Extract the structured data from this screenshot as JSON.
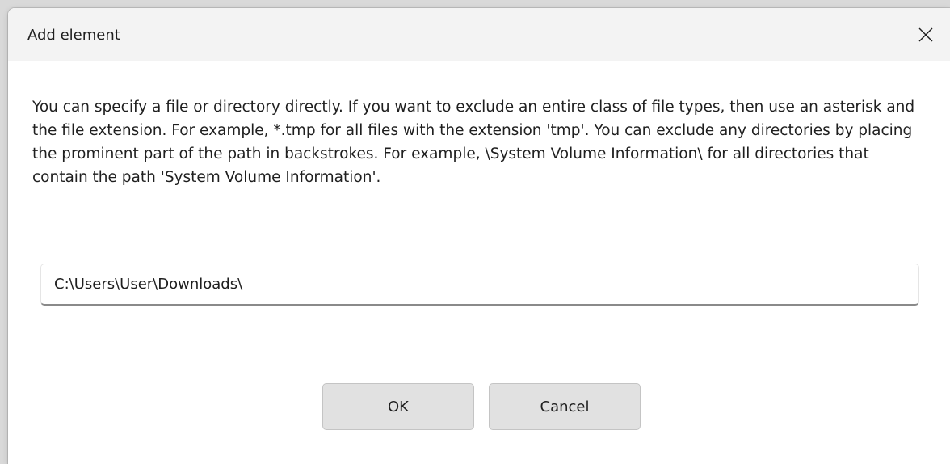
{
  "dialog": {
    "title": "Add element",
    "description": "You can specify a file or directory directly. If you want to exclude an entire class of file types, then use an asterisk and the file extension. For example, *.tmp for all files with the extension 'tmp'. You can exclude any directories by placing the prominent part of the path in backstrokes. For example, \\System Volume Information\\ for all directories that contain the path 'System Volume Information'.",
    "path_value": "C:\\Users\\User\\Downloads\\",
    "ok_label": "OK",
    "cancel_label": "Cancel",
    "close_icon": "close-icon"
  }
}
